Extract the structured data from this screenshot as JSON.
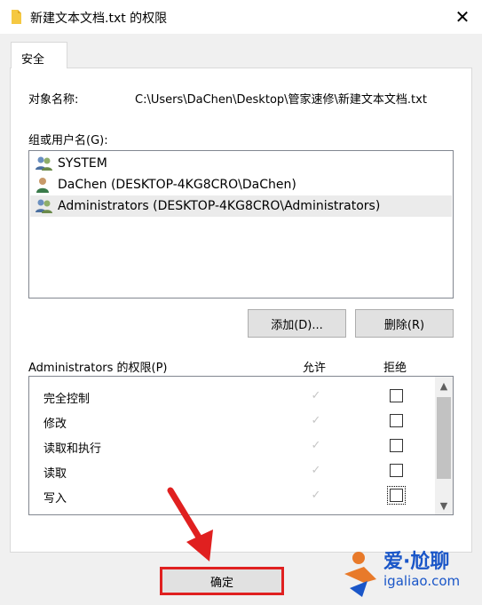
{
  "window": {
    "title": "新建文本文档.txt 的权限",
    "close_label": "✕"
  },
  "tab": {
    "label": "安全"
  },
  "object": {
    "label": "对象名称:",
    "value": "C:\\Users\\DaChen\\Desktop\\管家速修\\新建文本文档.txt"
  },
  "groups": {
    "label": "组或用户名(G):",
    "items": [
      {
        "name": "SYSTEM",
        "icon": "group-users-icon"
      },
      {
        "name": "DaChen (DESKTOP-4KG8CRO\\DaChen)",
        "icon": "user-icon"
      },
      {
        "name": "Administrators (DESKTOP-4KG8CRO\\Administrators)",
        "icon": "group-users-icon",
        "selected": true
      }
    ],
    "add_label": "添加(D)...",
    "remove_label": "删除(R)"
  },
  "permissions": {
    "label": "Administrators 的权限(P)",
    "allow_header": "允许",
    "deny_header": "拒绝",
    "rows": [
      {
        "name": "完全控制",
        "allow": true,
        "deny": false
      },
      {
        "name": "修改",
        "allow": true,
        "deny": false
      },
      {
        "name": "读取和执行",
        "allow": true,
        "deny": false
      },
      {
        "name": "读取",
        "allow": true,
        "deny": false
      },
      {
        "name": "写入",
        "allow": true,
        "deny": false
      }
    ]
  },
  "footer": {
    "ok_label": "确定"
  },
  "watermark": {
    "line1": "爱·尬聊",
    "line2": "igaliao.com"
  },
  "colors": {
    "highlight": "#e02020",
    "watermark": "#1a56c8"
  }
}
